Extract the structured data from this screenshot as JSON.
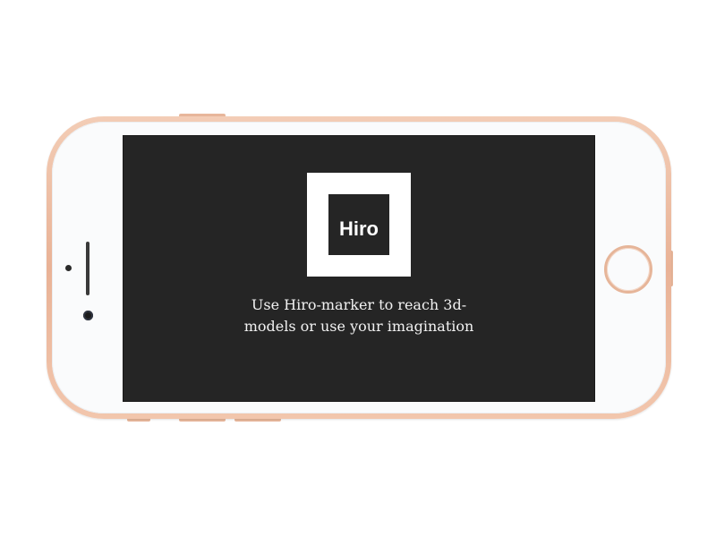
{
  "marker": {
    "label": "Hiro"
  },
  "instruction": {
    "text": "Use Hiro-marker to reach 3d-models or use your imagination"
  },
  "colors": {
    "screen_background": "#252525",
    "phone_frame": "#e9b296",
    "marker_border": "#ffffff"
  },
  "icons": {
    "home_button": "home-button-icon",
    "camera": "front-camera-icon",
    "speaker": "earpiece-speaker-icon",
    "sensor": "proximity-sensor-icon"
  }
}
